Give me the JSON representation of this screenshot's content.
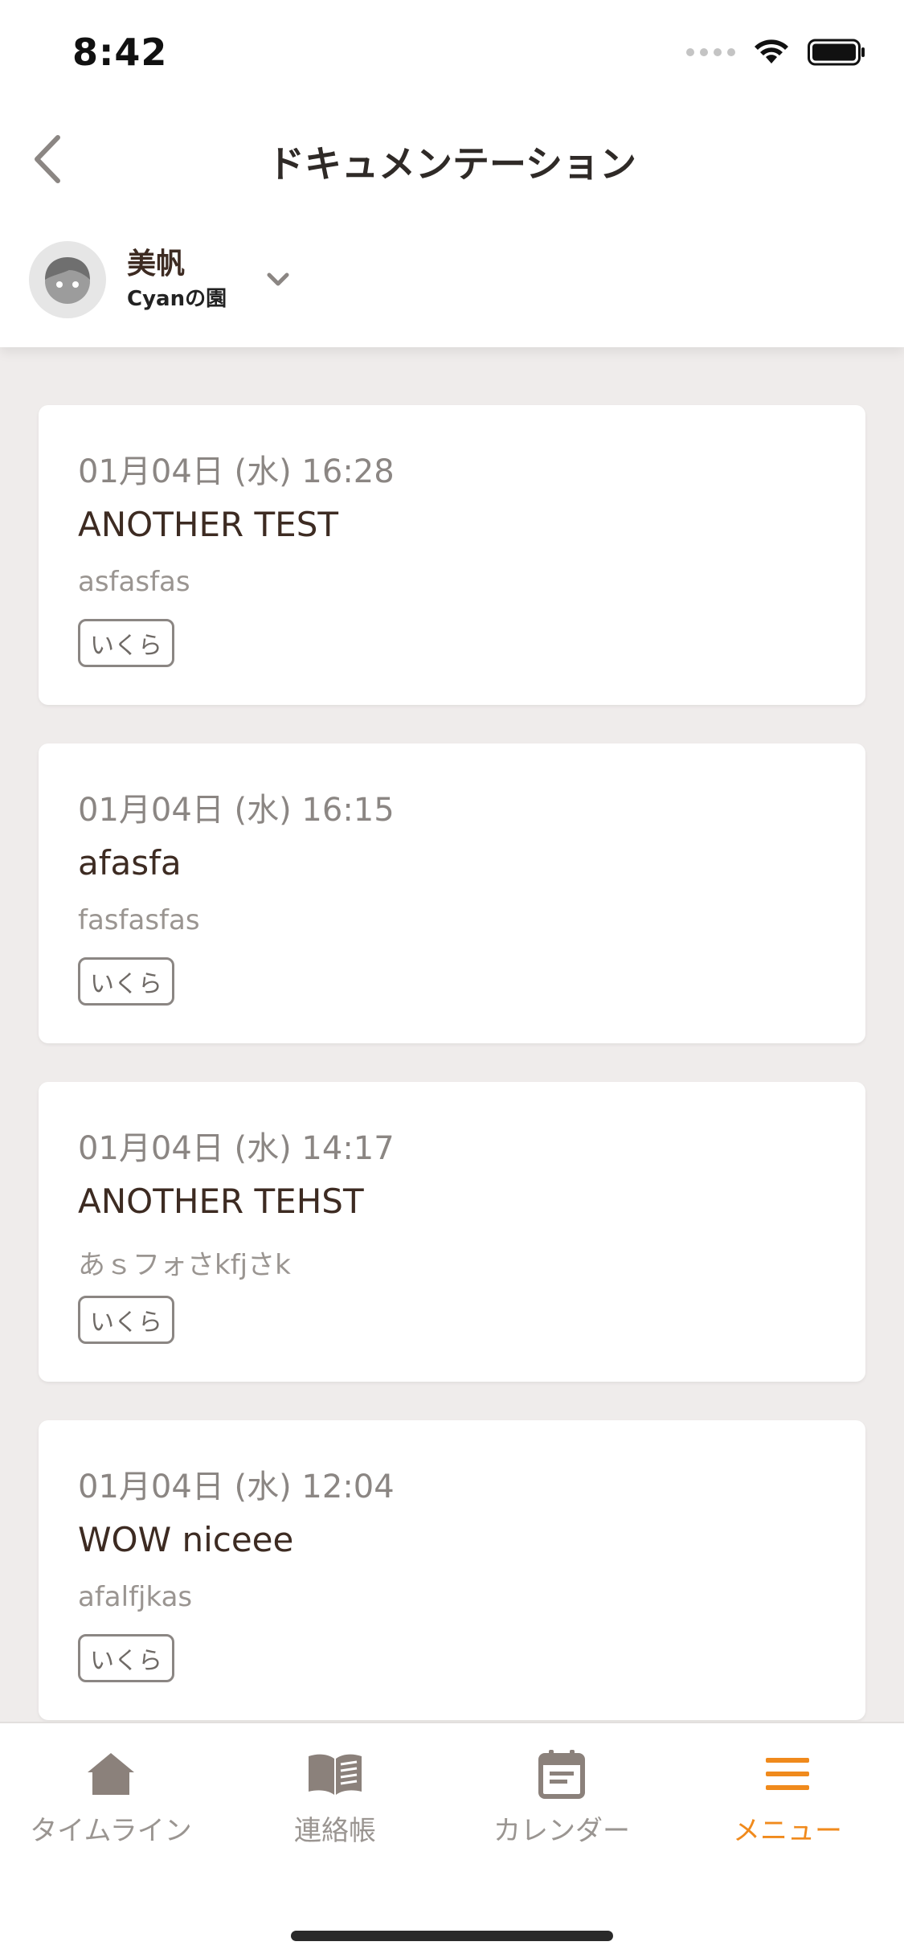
{
  "status_bar": {
    "time": "8:42"
  },
  "header": {
    "title": "ドキュメンテーション"
  },
  "child": {
    "name": "美帆",
    "school": "Cyanの園"
  },
  "documents": [
    {
      "date": "01月04日 (水) 16:28",
      "title": "ANOTHER TEST",
      "body": "asfasfas",
      "tag": "いくら"
    },
    {
      "date": "01月04日 (水) 16:15",
      "title": "afasfa",
      "body": "fasfasfas",
      "tag": "いくら"
    },
    {
      "date": "01月04日 (水) 14:17",
      "title": "ANOTHER TEHST",
      "body": "あｓフォさkfjさk",
      "tag": "いくら"
    },
    {
      "date": "01月04日 (水) 12:04",
      "title": "WOW niceee",
      "body": "afalfjkas",
      "tag": "いくら"
    }
  ],
  "tab_bar": {
    "items": [
      {
        "label": "タイムライン",
        "icon": "home-icon"
      },
      {
        "label": "連絡帳",
        "icon": "book-icon"
      },
      {
        "label": "カレンダー",
        "icon": "calendar-icon"
      },
      {
        "label": "メニュー",
        "icon": "menu-icon"
      }
    ],
    "active_index": 3
  },
  "colors": {
    "accent": "#f08a1c",
    "text_dark": "#3d2b22",
    "icon_gray": "#8b817b",
    "background": "#efeceb"
  }
}
